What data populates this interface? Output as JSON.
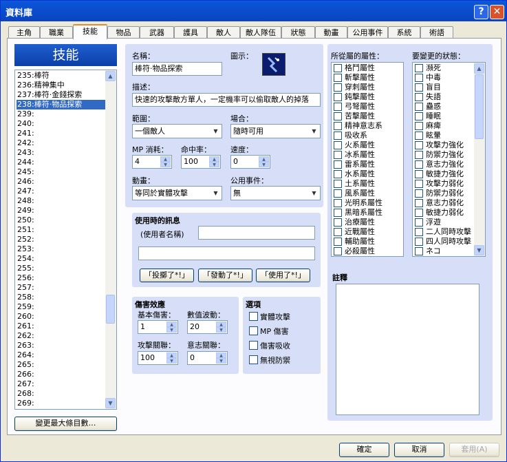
{
  "window": {
    "title": "資料庫",
    "help": "?",
    "close": "✕"
  },
  "tabs": [
    "主角",
    "職業",
    "技能",
    "物品",
    "武器",
    "護具",
    "敵人",
    "敵人隊伍",
    "狀態",
    "動畫",
    "公用事件",
    "系統",
    "術語"
  ],
  "selected_tab": "技能",
  "list": {
    "header": "技能",
    "items": [
      "235:棒符",
      "236:精神集中",
      "237:棒符·金錢探索",
      "238:棒符·物品探索",
      "239:",
      "240:",
      "241:",
      "242:",
      "243:",
      "244:",
      "245:",
      "246:",
      "247:",
      "248:",
      "249:",
      "250:",
      "251:",
      "252:",
      "253:",
      "254:",
      "255:",
      "256:",
      "257:",
      "258:",
      "259:",
      "260:",
      "261:",
      "262:",
      "263:",
      "264:",
      "265:",
      "266:",
      "267:",
      "268:",
      "269:"
    ],
    "selected_index": 3,
    "change_max_button": "變更最大條目數…"
  },
  "form": {
    "name_label": "名稱：",
    "name_value": "棒符·物品探索",
    "icon_label": "圖示：",
    "desc_label": "描述：",
    "desc_value": "快速的攻擊敵方單人，一定機率可以偷取敵人的掉落",
    "scope_label": "範圍：",
    "scope_value": "一個敵人",
    "occasion_label": "場合：",
    "occasion_value": "隨時可用",
    "mp_label": "MP 消耗：",
    "mp_value": "4",
    "hit_label": "命中率：",
    "hit_value": "100",
    "speed_label": "速度：",
    "speed_value": "0",
    "anim_label": "動畫：",
    "anim_value": "等同於實體攻擊",
    "common_event_label": "公用事件：",
    "common_event_value": "無"
  },
  "message": {
    "title": "使用時的訊息",
    "user_name_label": "(使用者名稱)",
    "line1_value": "",
    "line2_value": "",
    "btn_throw": "「投擲了*!」",
    "btn_activate": "「發動了*!」",
    "btn_use": "「使用了*!」"
  },
  "damage": {
    "title": "傷害效應",
    "base_label": "基本傷害：",
    "base_value": "1",
    "variance_label": "數值波動：",
    "variance_value": "20",
    "atk_label": "攻擊關聯：",
    "atk_value": "100",
    "spi_label": "意志關聯：",
    "spi_value": "0"
  },
  "options": {
    "title": "選項",
    "items": [
      "實體攻擊",
      "MP 傷害",
      "傷害吸收",
      "無視防禦"
    ]
  },
  "elements": {
    "label": "所從屬的屬性：",
    "items": [
      "格鬥屬性",
      "斬擊屬性",
      "穿刺屬性",
      "鈍擊屬性",
      "弓弩屬性",
      "苦擊屬性",
      "精神意志系",
      "吸收系",
      "火系屬性",
      "冰系屬性",
      "雷系屬性",
      "水系屬性",
      "土系屬性",
      "風系屬性",
      "光明系屬性",
      "黑暗系屬性",
      "治療屬性",
      "近戰屬性",
      "輔助屬性",
      "必殺屬性"
    ]
  },
  "states": {
    "label": "要變更的狀態：",
    "items": [
      "瀕死",
      "中毒",
      "盲目",
      "失語",
      "蠱惑",
      "睡眠",
      "麻痺",
      "眩暈",
      "攻擊力強化",
      "防禦力強化",
      "意志力強化",
      "敏捷力強化",
      "攻擊力弱化",
      "防禦力弱化",
      "意志力弱化",
      "敏捷力弱化",
      "浮遊",
      "二人同時攻擊",
      "四人同時攻擊",
      "ネコ"
    ]
  },
  "note": {
    "label": "註釋",
    "value": ""
  },
  "buttons": {
    "ok": "確定",
    "cancel": "取消",
    "apply": "套用(A)"
  },
  "colors": {
    "title_bar": "#0b4ed0",
    "selection": "#316ac5",
    "tab_highlight": "#e68b2c",
    "group_bg": "#d6dff7"
  }
}
